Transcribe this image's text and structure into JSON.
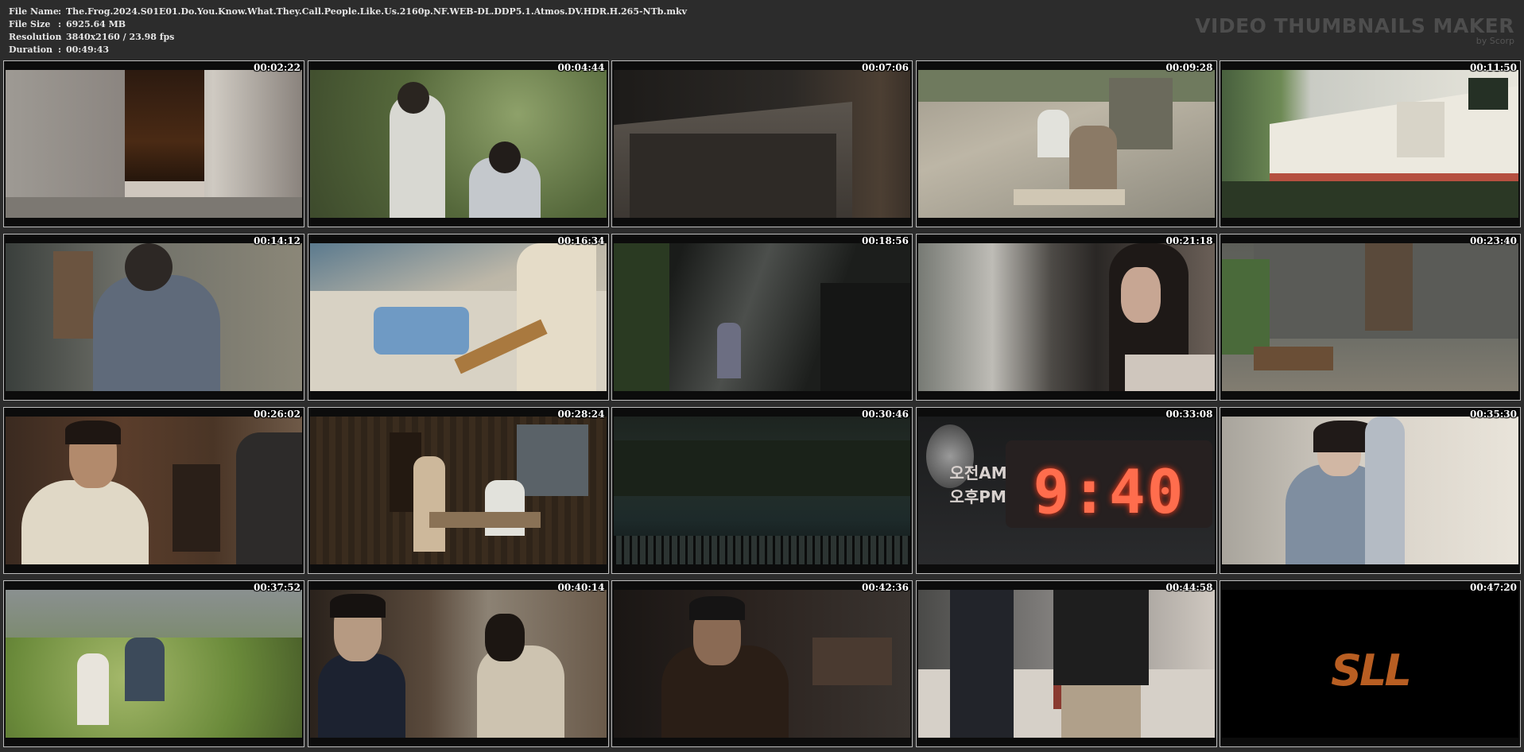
{
  "header": {
    "rows": [
      {
        "key": "File Name",
        "sep": ":",
        "value": "The.Frog.2024.S01E01.Do.You.Know.What.They.Call.People.Like.Us.2160p.NF.WEB-DL.DDP5.1.Atmos.DV.HDR.H.265-NTb.mkv"
      },
      {
        "key": "File Size",
        "sep": ":",
        "value": "6925.64 MB"
      },
      {
        "key": "Resolution",
        "sep": ":",
        "value": "3840x2160 / 23.98 fps"
      },
      {
        "key": "Duration",
        "sep": ":",
        "value": "00:49:43"
      }
    ]
  },
  "brand": {
    "title": "VIDEO THUMBNAILS MAKER",
    "subtitle": "by Scorp"
  },
  "thumbnails": [
    {
      "time": "00:02:22",
      "scene": "iced-drink-glass"
    },
    {
      "time": "00:04:44",
      "scene": "two-men-outdoors"
    },
    {
      "time": "00:07:06",
      "scene": "cardboard-box"
    },
    {
      "time": "00:09:28",
      "scene": "men-at-table-outdoors"
    },
    {
      "time": "00:11:50",
      "scene": "building-facade"
    },
    {
      "time": "00:14:12",
      "scene": "man-back-office"
    },
    {
      "time": "00:16:34",
      "scene": "cleaning-table"
    },
    {
      "time": "00:18:56",
      "scene": "dark-room-light-rays"
    },
    {
      "time": "00:21:18",
      "scene": "woman-at-window"
    },
    {
      "time": "00:23:40",
      "scene": "stone-house-courtyard"
    },
    {
      "time": "00:26:02",
      "scene": "man-in-shirt"
    },
    {
      "time": "00:28:24",
      "scene": "men-wood-room"
    },
    {
      "time": "00:30:46",
      "scene": "night-lake"
    },
    {
      "time": "00:33:08",
      "scene": "digital-clock",
      "clock_text": "9:40",
      "clock_label_1": "오전AM",
      "clock_label_2": "오후PM"
    },
    {
      "time": "00:35:30",
      "scene": "woman-uniform"
    },
    {
      "time": "00:37:52",
      "scene": "people-in-bushes"
    },
    {
      "time": "00:40:14",
      "scene": "men-with-glasses"
    },
    {
      "time": "00:42:36",
      "scene": "man-with-cap-dark"
    },
    {
      "time": "00:44:58",
      "scene": "bedroom-men"
    },
    {
      "time": "00:47:20",
      "scene": "sll-logo",
      "logo_text": "SLL"
    }
  ]
}
